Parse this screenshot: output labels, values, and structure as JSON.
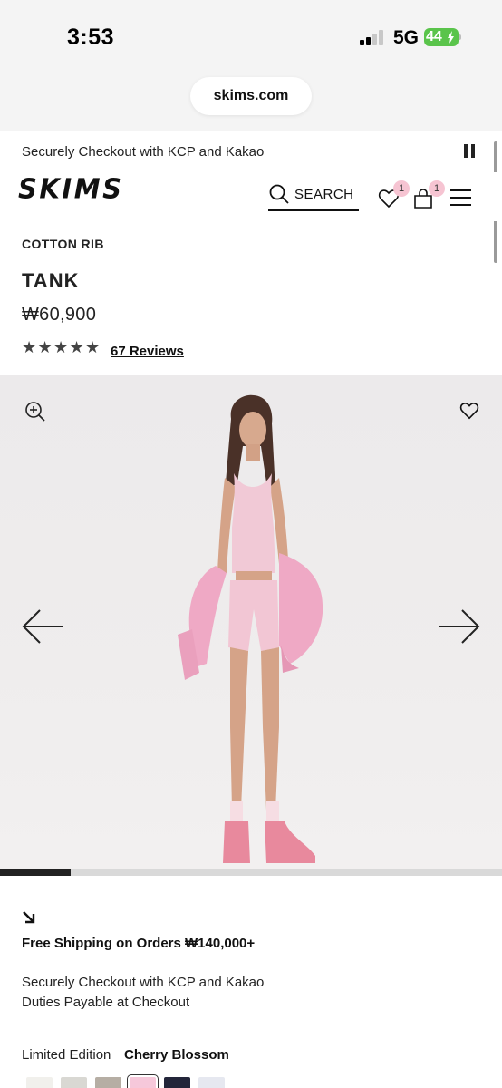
{
  "status_bar": {
    "time": "3:53",
    "network": "5G",
    "battery": "44"
  },
  "browser": {
    "url": "skims.com"
  },
  "banner": {
    "text": "Securely Checkout with KCP and Kakao"
  },
  "header": {
    "logo": "SKIMS",
    "search_label": "SEARCH",
    "wishlist_count": "1",
    "bag_count": "1"
  },
  "product": {
    "category": "COTTON RIB",
    "title": "TANK",
    "price": "₩60,900",
    "rating": 5,
    "reviews_label": "67 Reviews"
  },
  "gallery": {
    "progress": 0.14
  },
  "info": {
    "shipping": "Free Shipping on Orders ₩140,000+",
    "checkout_line1": "Securely Checkout with KCP and Kakao",
    "checkout_line2": "Duties Payable at Checkout",
    "edition_label": "Limited Edition",
    "color_name": "Cherry Blossom"
  },
  "swatches": [
    {
      "color": "#f1f0ec",
      "selected": false
    },
    {
      "color": "#d9d8d3",
      "selected": false
    },
    {
      "color": "#b6aea4",
      "selected": false
    },
    {
      "color": "#f6c8da",
      "selected": true
    },
    {
      "color": "#23263a",
      "selected": false
    },
    {
      "color": "#e6e8f0",
      "selected": false
    }
  ],
  "colors": {
    "accent_badge": "#f6c4d2",
    "battery": "#5ac44b"
  }
}
